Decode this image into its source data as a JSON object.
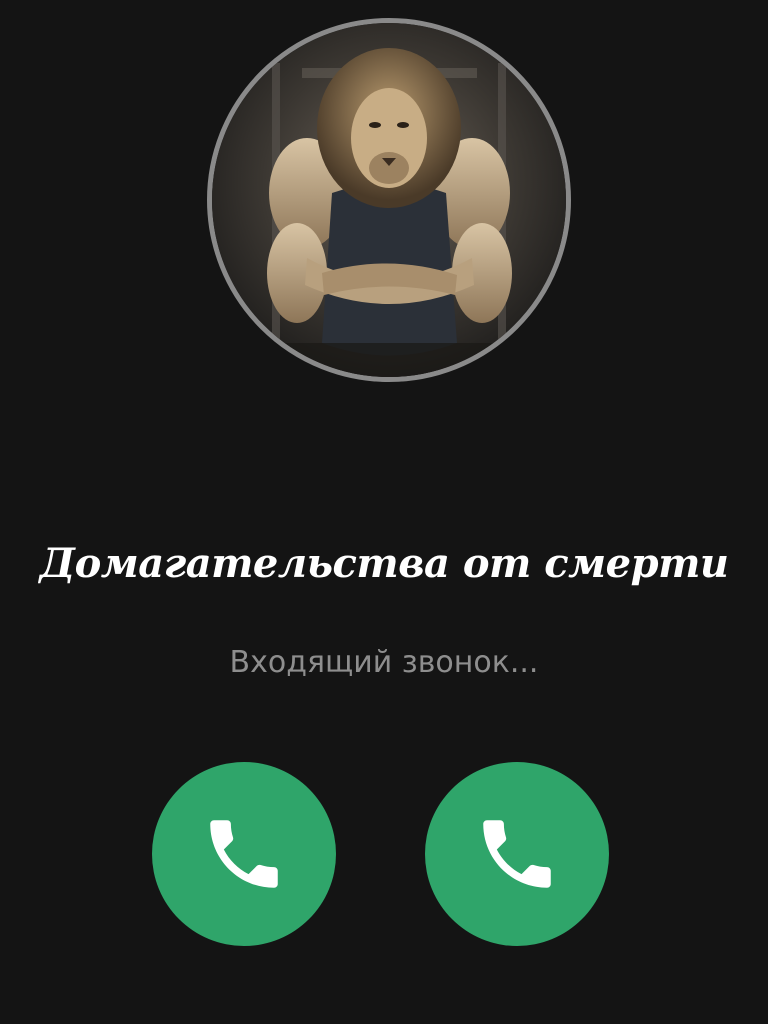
{
  "call": {
    "caller_name": "Домагательства от смерти",
    "status": "Входящий звонок...",
    "avatar_icon": "lion-bodybuilder-avatar"
  },
  "actions": [
    {
      "icon": "phone-icon",
      "color": "#2fa56a"
    },
    {
      "icon": "phone-icon",
      "color": "#2fa56a"
    }
  ],
  "colors": {
    "background": "#141414",
    "avatar_ring": "#8a8a8a",
    "accept_green": "#2fa56a",
    "status_text": "#8e8e8e"
  }
}
